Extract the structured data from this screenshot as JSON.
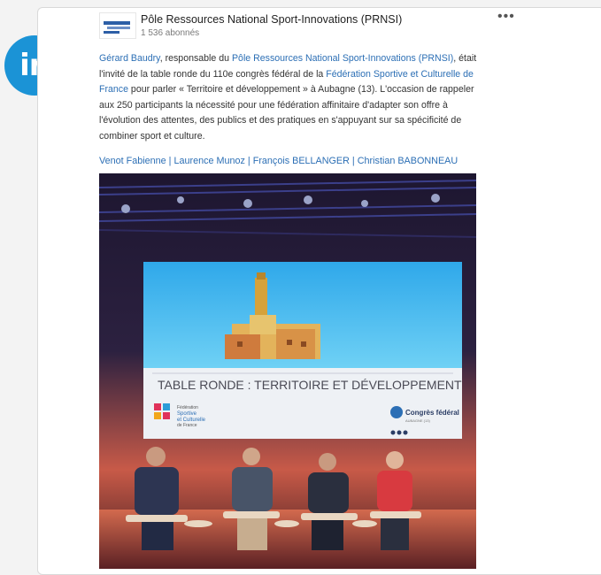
{
  "author": {
    "name": "Pôle Ressources National Sport-Innovations (PRNSI)",
    "followers": "1 536 abonnés"
  },
  "badge": {
    "label": "in"
  },
  "post": {
    "p1_mention": "Gérard Baudry",
    "p1_a": ", responsable du ",
    "p1_org_link": "Pôle Ressources National Sport-Innovations (PRNSI)",
    "p1_b": ", était l'invité de la table ronde du 110e congrès fédéral de la ",
    "p1_fed_link": "Fédération Sportive et Culturelle de France",
    "p1_c": " pour parler « Territoire et développement » à Aubagne (13). L'occasion de rappeler aux 250 participants la nécessité pour une fédération affinitaire d'adapter son offre à l'évolution des attentes, des publics et des pratiques en s'appuyant sur sa spécificité de combiner sport et culture."
  },
  "tags": [
    "Venot Fabienne",
    "Laurence Munoz",
    "François BELLANGER",
    "Christian BABONNEAU"
  ],
  "tag_separator": " | ",
  "photo": {
    "screen_title": "TABLE RONDE : TERRITOIRE ET DÉVELOPPEMENT",
    "org_logo_line1": "Fédération",
    "org_logo_line2": "Sportive",
    "org_logo_line3": "et Culturelle",
    "org_logo_line4": "de France",
    "congress_label": "Congrès fédéral",
    "congress_sub": "AUBAGNE (13)"
  },
  "colors": {
    "linkedin_blue": "#1b93d6",
    "link_blue": "#2c6fb5",
    "screen_bg": "#eef1f5",
    "screen_sky": "#49b8ee",
    "stage_red": "#c8323b"
  }
}
